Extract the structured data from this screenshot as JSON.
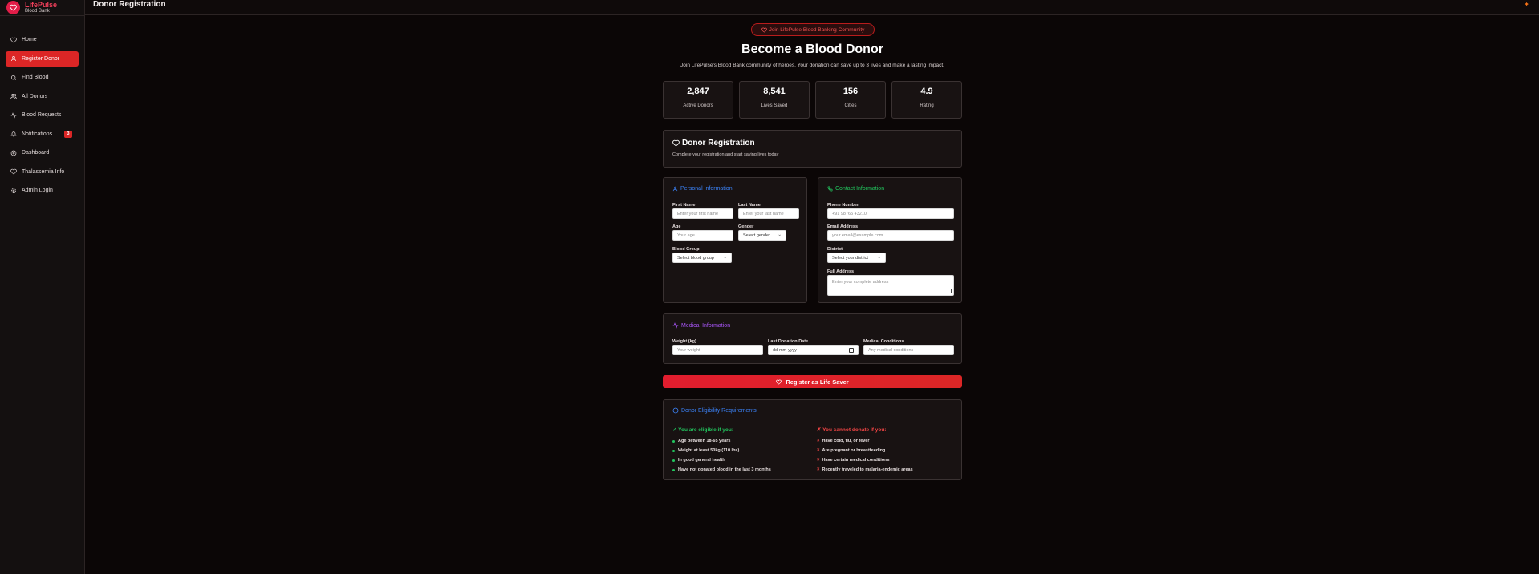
{
  "brand": {
    "name": "LifePulse",
    "sub": "Blood Bank"
  },
  "sidebar": {
    "items": [
      {
        "label": "Home",
        "icon": "heart-icon"
      },
      {
        "label": "Register Donor",
        "icon": "user-icon",
        "active": true
      },
      {
        "label": "Find Blood",
        "icon": "search-icon"
      },
      {
        "label": "All Donors",
        "icon": "users-icon"
      },
      {
        "label": "Blood Requests",
        "icon": "activity-icon"
      },
      {
        "label": "Notifications",
        "icon": "bell-icon",
        "badge": "3"
      },
      {
        "label": "Dashboard",
        "icon": "dashboard-icon"
      },
      {
        "label": "Thalassemia Info",
        "icon": "heart-icon"
      },
      {
        "label": "Admin Login",
        "icon": "settings-icon"
      }
    ]
  },
  "header": {
    "title": "Donor Registration"
  },
  "hero": {
    "pill": "Join LifePulse Blood Banking Community",
    "title": "Become a Blood Donor",
    "subtitle": "Join LifePulse's Blood Bank community of heroes. Your donation can save up to 3 lives and make a lasting impact."
  },
  "stats": [
    {
      "value": "2,847",
      "label": "Active Donors"
    },
    {
      "value": "8,541",
      "label": "Lives Saved"
    },
    {
      "value": "156",
      "label": "Cities"
    },
    {
      "value": "4.9",
      "label": "Rating"
    }
  ],
  "registration": {
    "title": "Donor Registration",
    "subtitle": "Complete your registration and start saving lives today"
  },
  "personal": {
    "title": "Personal Information",
    "first_name": {
      "label": "First Name",
      "placeholder": "Enter your first name"
    },
    "last_name": {
      "label": "Last Name",
      "placeholder": "Enter your last name"
    },
    "age": {
      "label": "Age",
      "placeholder": "Your age"
    },
    "gender": {
      "label": "Gender",
      "value": "Select gender"
    },
    "blood_group": {
      "label": "Blood Group",
      "value": "Select blood group"
    }
  },
  "contact": {
    "title": "Contact Information",
    "phone": {
      "label": "Phone Number",
      "placeholder": "+91 98765 43210"
    },
    "email": {
      "label": "Email Address",
      "placeholder": "your.email@example.com"
    },
    "district": {
      "label": "District",
      "value": "Select your district"
    },
    "address": {
      "label": "Full Address",
      "placeholder": "Enter your complete address"
    }
  },
  "medical": {
    "title": "Medical Information",
    "weight": {
      "label": "Weight (kg)",
      "placeholder": "Your weight"
    },
    "last_donation": {
      "label": "Last Donation Date",
      "value": "dd-mm-yyyy"
    },
    "conditions": {
      "label": "Medical Conditions",
      "placeholder": "Any medical conditions"
    }
  },
  "submit_label": "Register as Life Saver",
  "eligibility": {
    "title": "Donor Eligibility Requirements",
    "eligible_head": "✓ You are eligible if you:",
    "eligible": [
      "Age between 18-65 years",
      "Weight at least 50kg (110 lbs)",
      "In good general health",
      "Have not donated blood in the last 3 months"
    ],
    "not_eligible_head": "✗ You cannot donate if you:",
    "not_eligible": [
      "Have cold, flu, or fever",
      "Are pregnant or breastfeeding",
      "Have certain medical conditions",
      "Recently traveled to malaria-endemic areas"
    ]
  },
  "colors": {
    "accent": "#dc2626",
    "blue": "#3b82f6",
    "green": "#22c55e",
    "purple": "#a855f7"
  }
}
